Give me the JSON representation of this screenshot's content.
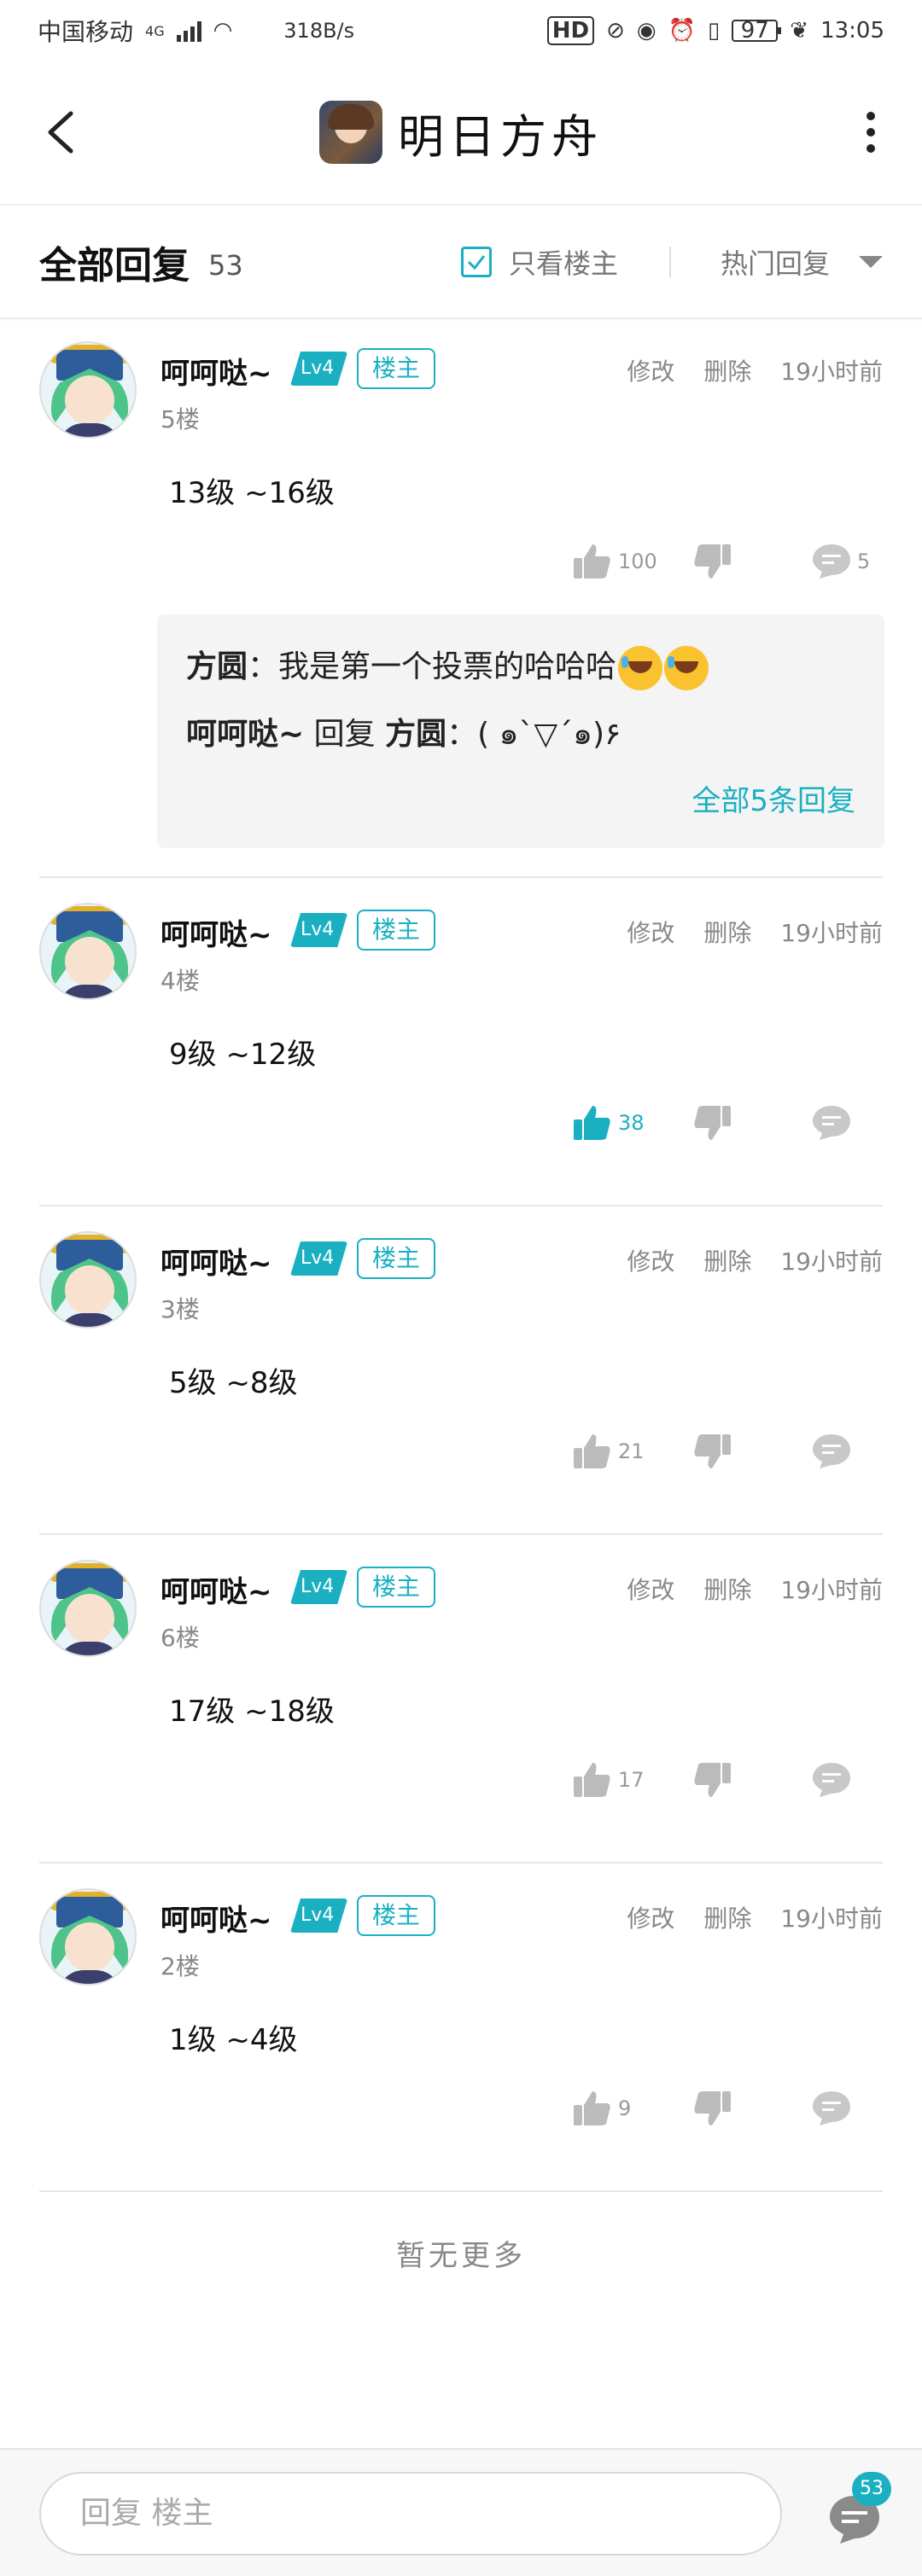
{
  "status_bar": {
    "carrier": "中国移动",
    "network": "4G",
    "speed": "318B/s",
    "battery": "97",
    "time": "13:05"
  },
  "app_bar": {
    "title": "明日方舟",
    "back_icon": "back-arrow-icon",
    "more_icon": "more-vertical-icon"
  },
  "filter_bar": {
    "title": "全部回复",
    "count": "53",
    "only_op_label": "只看楼主",
    "only_op_checked": true,
    "sort_label": "热门回复"
  },
  "posts": [
    {
      "username": "呵呵哒~",
      "level": "Lv4",
      "owner_tag": "楼主",
      "edit": "修改",
      "delete": "删除",
      "time": "19小时前",
      "floor": "5楼",
      "content": "13级 ~16级",
      "likes": "100",
      "liked": false,
      "comments": "5",
      "replies": [
        {
          "author": "方圆",
          "text": "：我是第一个投票的哈哈哈"
        },
        {
          "author": "呵呵哒~",
          "verb": "回复",
          "target": "方圆",
          "text": "：( ๑`▽´๑)۶"
        }
      ],
      "more_replies": "全部5条回复"
    },
    {
      "username": "呵呵哒~",
      "level": "Lv4",
      "owner_tag": "楼主",
      "edit": "修改",
      "delete": "删除",
      "time": "19小时前",
      "floor": "4楼",
      "content": "9级 ~12级",
      "likes": "38",
      "liked": true,
      "comments": ""
    },
    {
      "username": "呵呵哒~",
      "level": "Lv4",
      "owner_tag": "楼主",
      "edit": "修改",
      "delete": "删除",
      "time": "19小时前",
      "floor": "3楼",
      "content": "5级 ~8级",
      "likes": "21",
      "liked": false,
      "comments": ""
    },
    {
      "username": "呵呵哒~",
      "level": "Lv4",
      "owner_tag": "楼主",
      "edit": "修改",
      "delete": "删除",
      "time": "19小时前",
      "floor": "6楼",
      "content": "17级 ~18级",
      "likes": "17",
      "liked": false,
      "comments": ""
    },
    {
      "username": "呵呵哒~",
      "level": "Lv4",
      "owner_tag": "楼主",
      "edit": "修改",
      "delete": "删除",
      "time": "19小时前",
      "floor": "2楼",
      "content": "1级 ~4级",
      "likes": "9",
      "liked": false,
      "comments": ""
    }
  ],
  "footer": {
    "no_more": "暂无更多"
  },
  "bottom_bar": {
    "reply_placeholder": "回复 楼主",
    "comment_badge": "53"
  },
  "colors": {
    "accent": "#1ab0c2",
    "text": "#111111",
    "muted": "#888888"
  }
}
